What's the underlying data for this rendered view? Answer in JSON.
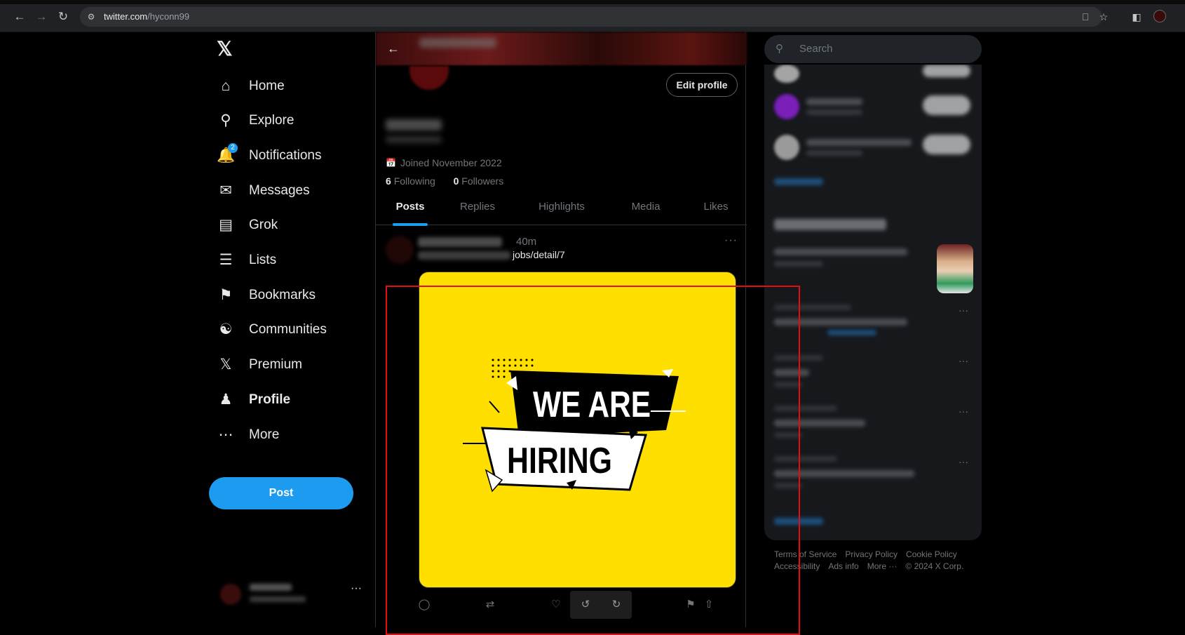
{
  "browser": {
    "url_host": "twitter.com",
    "url_path": "/hyconn99"
  },
  "nav": {
    "items": [
      {
        "label": "Home",
        "icon": "home-icon"
      },
      {
        "label": "Explore",
        "icon": "search-icon"
      },
      {
        "label": "Notifications",
        "icon": "bell-icon",
        "badge": "2"
      },
      {
        "label": "Messages",
        "icon": "envelope-icon"
      },
      {
        "label": "Grok",
        "icon": "grok-icon"
      },
      {
        "label": "Lists",
        "icon": "list-icon"
      },
      {
        "label": "Bookmarks",
        "icon": "bookmark-icon"
      },
      {
        "label": "Communities",
        "icon": "communities-icon"
      },
      {
        "label": "Premium",
        "icon": "x-logo-icon"
      },
      {
        "label": "Profile",
        "icon": "person-icon"
      },
      {
        "label": "More",
        "icon": "more-circle-icon"
      }
    ],
    "post_label": "Post"
  },
  "profile": {
    "edit_label": "Edit profile",
    "joined": "Joined November 2022",
    "following_count": "6",
    "following_label": "Following",
    "followers_count": "0",
    "followers_label": "Followers"
  },
  "tabs": [
    "Posts",
    "Replies",
    "Highlights",
    "Media",
    "Likes"
  ],
  "tweet": {
    "time": "40m",
    "text_visible": "jobs/detail/7",
    "image_line1": "WE ARE",
    "image_line2": "HIRING"
  },
  "right": {
    "search_placeholder": "Search"
  },
  "footer": {
    "links": [
      "Terms of Service",
      "Privacy Policy",
      "Cookie Policy",
      "Accessibility",
      "Ads info",
      "More ···",
      "© 2024 X Corp."
    ]
  },
  "colors": {
    "accent": "#1d9bf0",
    "image_bg": "#ffdf00",
    "highlight_box": "#e01010"
  }
}
